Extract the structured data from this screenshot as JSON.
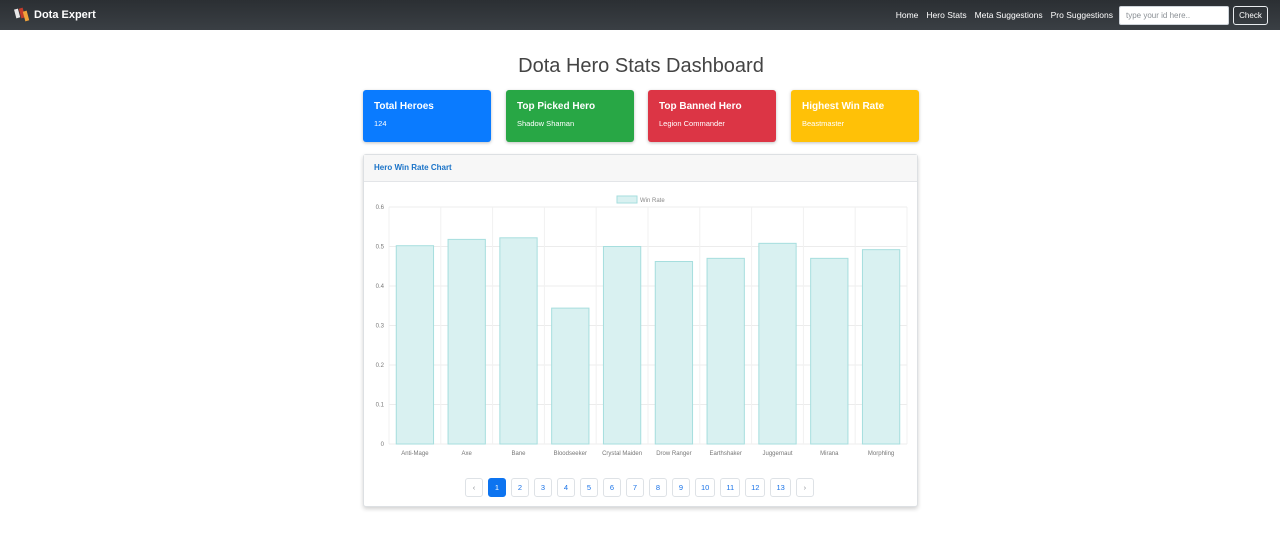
{
  "navbar": {
    "brand": "Dota Expert",
    "links": [
      "Home",
      "Hero Stats",
      "Meta Suggestions",
      "Pro Suggestions"
    ],
    "search_placeholder": "type your id here..",
    "search_value": "",
    "check_label": "Check"
  },
  "page": {
    "title": "Dota Hero Stats Dashboard"
  },
  "cards": [
    {
      "title": "Total Heroes",
      "value": "124",
      "color": "#0a7bff"
    },
    {
      "title": "Top Picked Hero",
      "value": "Shadow Shaman",
      "color": "#28a745"
    },
    {
      "title": "Top Banned Hero",
      "value": "Legion Commander",
      "color": "#dc3545"
    },
    {
      "title": "Highest Win Rate",
      "value": "Beastmaster",
      "color": "#ffc107"
    }
  ],
  "chart_card": {
    "header": "Hero Win Rate Chart"
  },
  "chart_data": {
    "type": "bar",
    "categories": [
      "Anti-Mage",
      "Axe",
      "Bane",
      "Bloodseeker",
      "Crystal Maiden",
      "Drow Ranger",
      "Earthshaker",
      "Juggernaut",
      "Mirana",
      "Morphling"
    ],
    "series": [
      {
        "name": "Win Rate",
        "values": [
          0.502,
          0.518,
          0.522,
          0.344,
          0.5,
          0.462,
          0.47,
          0.508,
          0.47,
          0.492
        ]
      }
    ],
    "yticks": [
      "0",
      "0.1",
      "0.2",
      "0.3",
      "0.4",
      "0.5",
      "0.6"
    ],
    "ylim": [
      0,
      0.6
    ],
    "grid": true,
    "legend": "top-center",
    "bar_fill": "#d9f1f1",
    "bar_stroke": "#a6dede"
  },
  "pagination": {
    "prev": "‹",
    "next": "›",
    "pages": [
      "1",
      "2",
      "3",
      "4",
      "5",
      "6",
      "7",
      "8",
      "9",
      "10",
      "11",
      "12",
      "13"
    ],
    "active": "1"
  }
}
